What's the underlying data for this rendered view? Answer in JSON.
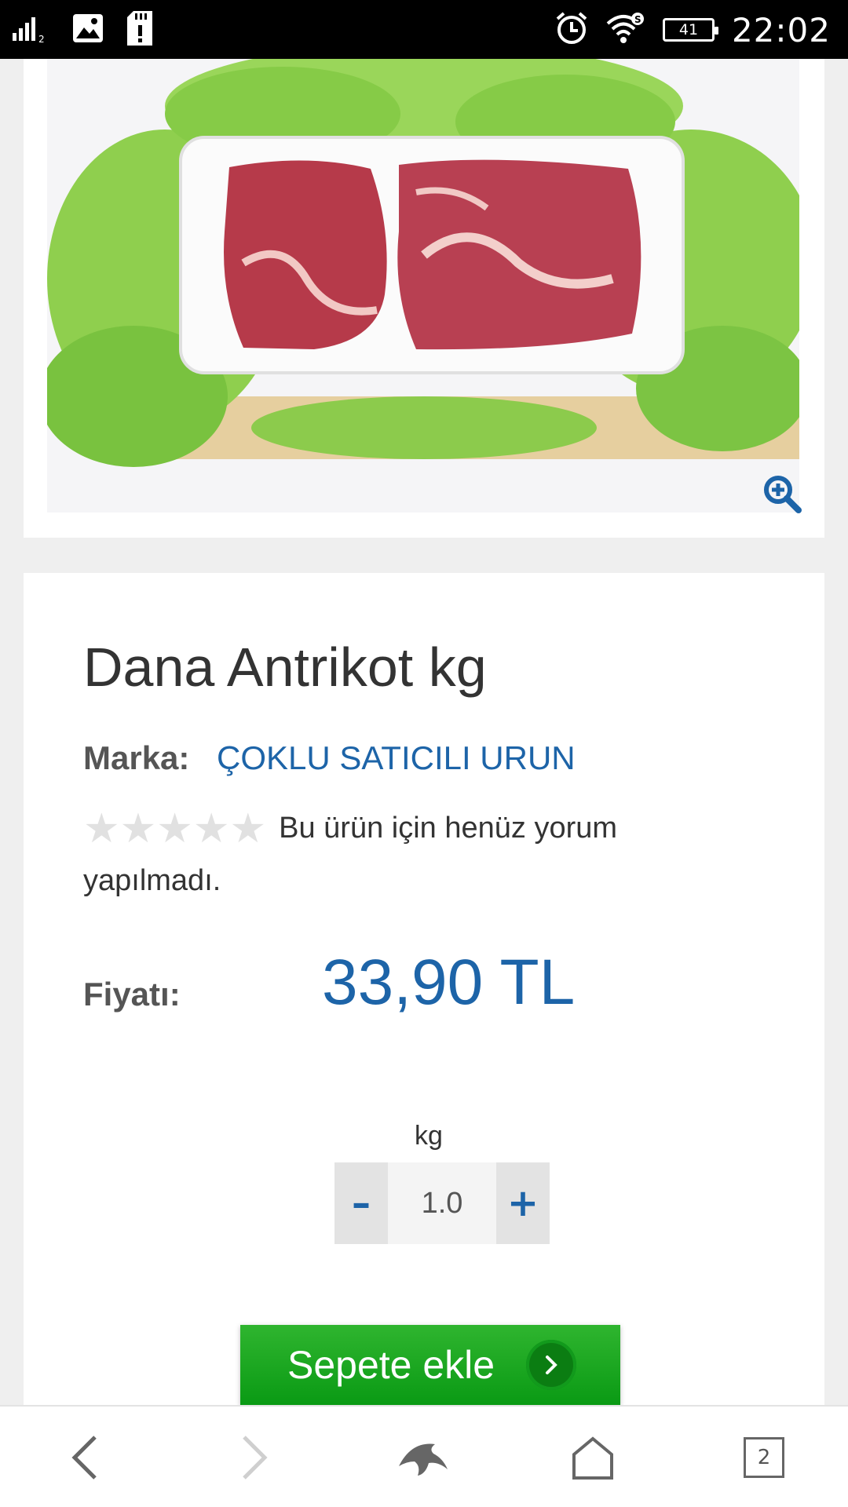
{
  "status_bar": {
    "signal_sub": "2",
    "battery_level": "41",
    "time": "22:02"
  },
  "product": {
    "title": "Dana Antrikot kg",
    "brand_label": "Marka:",
    "brand_name": "ÇOKLU SATICILI URUN",
    "rating_stars_filled": 0,
    "rating_stars_total": 5,
    "review_text": "Bu ürün için henüz yorum yapılmadı.",
    "price_label": "Fiyatı:",
    "price_value": "33,90 TL",
    "unit": "kg",
    "quantity": "1.0",
    "minus_label": "–",
    "plus_label": "+",
    "add_to_cart_label": "Sepete ekle"
  },
  "browser_bar": {
    "tab_count": "2"
  },
  "colors": {
    "accent_blue": "#1d64a8",
    "cart_green": "#1aa620",
    "star_empty": "#e1e1e1"
  },
  "icons": [
    "signal-icon",
    "image-icon",
    "sd-card-icon",
    "alarm-icon",
    "wifi-icon",
    "battery-icon",
    "zoom-in-icon",
    "back-icon",
    "forward-icon",
    "dolphin-icon",
    "home-icon",
    "tabs-icon",
    "chevron-right-icon",
    "star-icon"
  ]
}
